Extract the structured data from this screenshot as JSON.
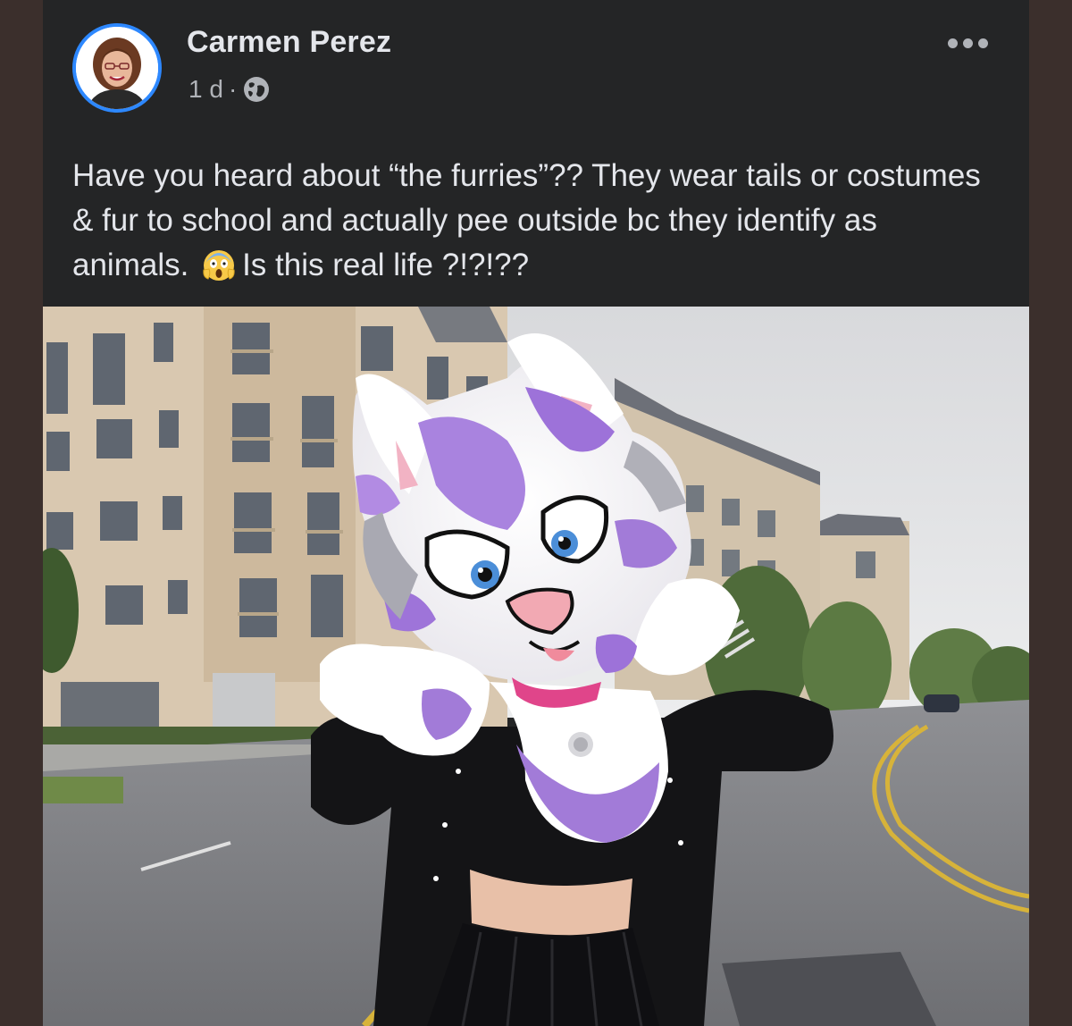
{
  "post": {
    "author": "Carmen Perez",
    "time": "1 d",
    "separator": "·",
    "audience_icon": "globe-icon",
    "more_icon": "more-options-icon",
    "text_part1": "Have you heard about “the furries”?? They wear tails or costumes & fur to school and actually pee outside bc they identify as animals.",
    "emoji": "face-screaming-in-fear-emoji",
    "text_part2": "Is this real life ?!?!??"
  },
  "photo": {
    "subject": "person in purple and white fursuit head wearing black varsity jacket on street"
  },
  "colors": {
    "post_background": "#242526",
    "frame_background": "#3b2f2c",
    "avatar_ring": "#2d88ff",
    "primary_text": "#e4e6eb",
    "secondary_text": "#b0b3b8"
  }
}
